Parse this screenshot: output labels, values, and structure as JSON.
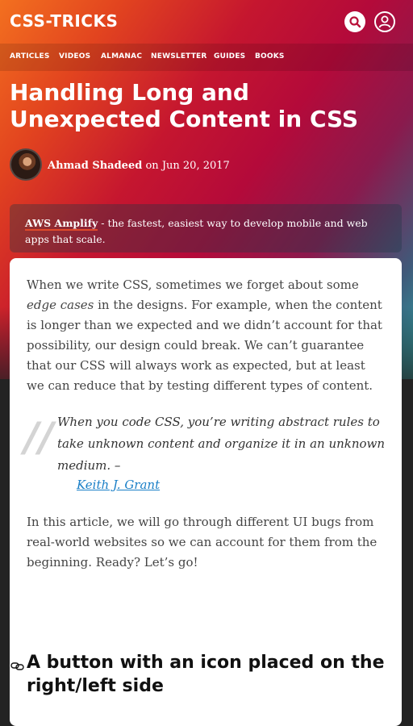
{
  "header": {
    "logo": "CSS-TRICKS",
    "search_icon": "search-icon",
    "account_icon": "user-icon"
  },
  "nav": {
    "items": [
      "ARTICLES",
      "VIDEOS",
      "ALMANAC",
      "NEWSLETTER",
      "GUIDES",
      "BOOKS"
    ]
  },
  "article": {
    "title": "Handling Long and Unexpected Content in CSS",
    "author": "Ahmad Shadeed",
    "date_prefix": "on",
    "date": "Jun 20, 2017"
  },
  "ad": {
    "brand": "AWS Amplify",
    "text": "- the fastest, easiest way to develop mobile and web apps that scale."
  },
  "content": {
    "intro_before": "When we write CSS, sometimes we forget about some ",
    "intro_em": "edge cases",
    "intro_after": " in the designs. For example, when the content is longer than we expected and we didn’t account for that possibility, our design could break. We can’t guarantee that our CSS will always work as expected, but at least we can reduce that by testing different types of content.",
    "quote": "When you code CSS, you’re writing abstract rules to take unknown content and organize it in an unknown medium. –",
    "quote_author": "Keith J. Grant",
    "para2": "In this article, we will go through different UI bugs from real-world websites so we can account for them from the beginning. Ready? Let’s go!",
    "heading": "A button with an icon placed on the right/left side"
  },
  "colors": {
    "accent_red": "#c5162f",
    "accent_orange": "#f3701f",
    "link_blue": "#1a7fc7"
  }
}
